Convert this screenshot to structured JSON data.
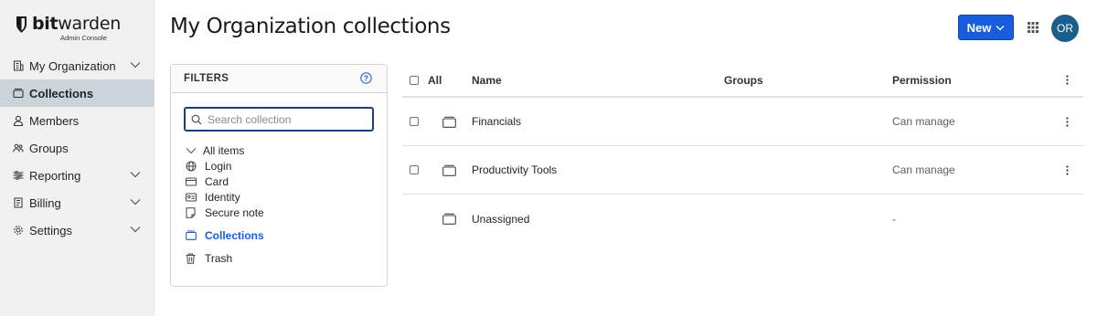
{
  "logo": {
    "text_bold": "bit",
    "text_light": "warden",
    "subtitle": "Admin Console"
  },
  "sidebar": {
    "items": [
      {
        "label": "My Organization",
        "icon": "building-icon",
        "expandable": true
      },
      {
        "label": "Collections",
        "icon": "collection-icon",
        "active": true
      },
      {
        "label": "Members",
        "icon": "user-icon"
      },
      {
        "label": "Groups",
        "icon": "users-icon"
      },
      {
        "label": "Reporting",
        "icon": "sliders-icon",
        "expandable": true
      },
      {
        "label": "Billing",
        "icon": "billing-icon",
        "expandable": true
      },
      {
        "label": "Settings",
        "icon": "gear-icon",
        "expandable": true
      }
    ]
  },
  "header": {
    "title": "My Organization collections",
    "new_label": "New",
    "avatar_initials": "OR"
  },
  "filters": {
    "title": "FILTERS",
    "search_placeholder": "Search collection",
    "all_items": "All items",
    "types": [
      {
        "label": "Login",
        "icon": "globe-icon"
      },
      {
        "label": "Card",
        "icon": "card-icon"
      },
      {
        "label": "Identity",
        "icon": "id-card-icon"
      },
      {
        "label": "Secure note",
        "icon": "note-icon"
      }
    ],
    "collections": "Collections",
    "trash": "Trash"
  },
  "table": {
    "headers": {
      "all": "All",
      "name": "Name",
      "groups": "Groups",
      "permission": "Permission"
    },
    "rows": [
      {
        "name": "Financials",
        "groups": "",
        "permission": "Can manage",
        "selectable": true
      },
      {
        "name": "Productivity Tools",
        "groups": "",
        "permission": "Can manage",
        "selectable": true
      },
      {
        "name": "Unassigned",
        "groups": "",
        "permission": "-",
        "selectable": false
      }
    ]
  },
  "colors": {
    "primary": "#175ddc",
    "sidebar_bg": "#f1f1f1",
    "active_bg": "#ccd3db",
    "avatar": "#1a5f8a"
  }
}
